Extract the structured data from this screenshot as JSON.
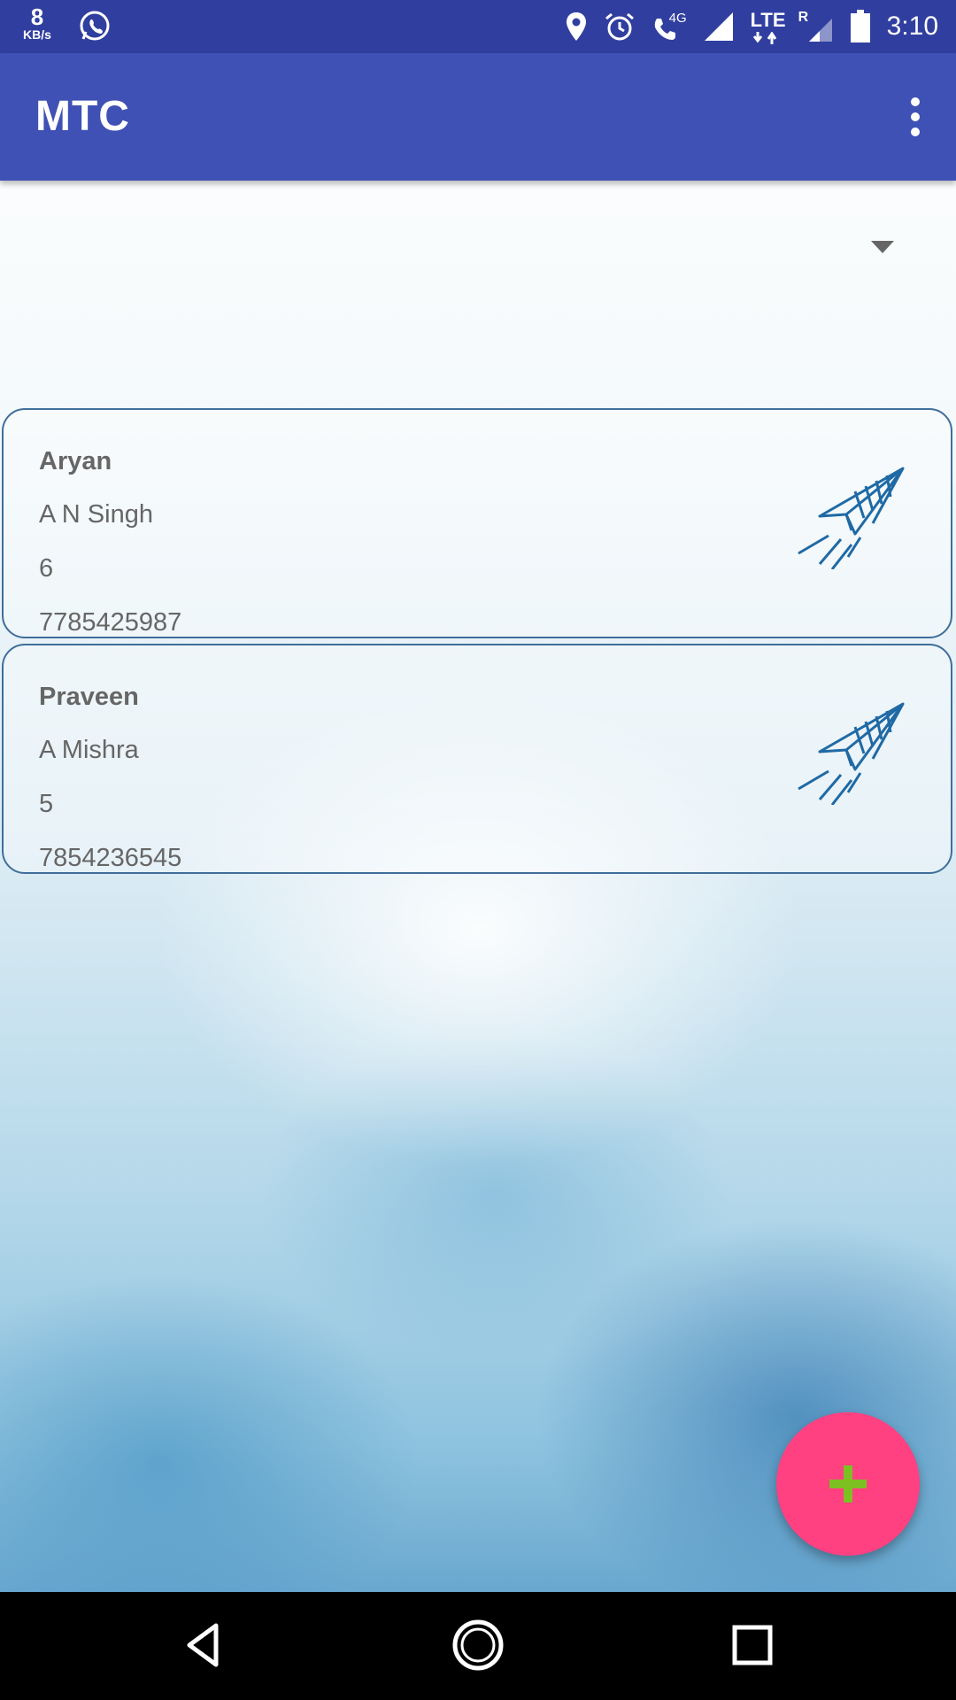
{
  "status_bar": {
    "speed_value": "8",
    "speed_unit": "KB/s",
    "network_4g": "4G",
    "network_lte": "LTE",
    "roaming": "R",
    "time": "3:10"
  },
  "app_bar": {
    "title": "MTC"
  },
  "contacts": [
    {
      "name": "Aryan",
      "line2": "A N Singh",
      "line3": "6",
      "phone": "7785425987"
    },
    {
      "name": "Praveen",
      "line2": "A Mishra",
      "line3": "5",
      "phone": "7854236545"
    }
  ],
  "fab": {
    "icon": "plus-icon",
    "color": "#ff4081",
    "icon_color": "#7cc121"
  },
  "colors": {
    "status_bar": "#303f9f",
    "app_bar": "#3f51b5",
    "card_border": "#3f6e9a"
  }
}
